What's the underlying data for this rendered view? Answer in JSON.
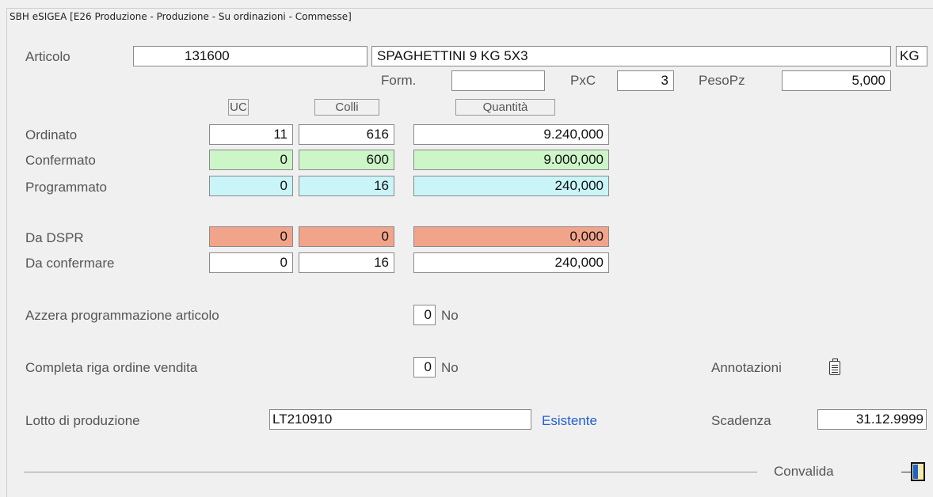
{
  "window": {
    "title": "SBH eSIGEA [E26 Produzione - Produzione - Su ordinazioni - Commesse]"
  },
  "articolo": {
    "label": "Articolo",
    "code": "131600",
    "description": "SPAGHETTINI 9 KG 5X3",
    "unit": "KG"
  },
  "format": {
    "form_label": "Form.",
    "form_value": "",
    "pxc_label": "PxC",
    "pxc_value": "3",
    "pesopz_label": "PesoPz",
    "pesopz_value": "5,000"
  },
  "columns": {
    "uc": "UC",
    "colli": "Colli",
    "quantita": "Quantità"
  },
  "rows": [
    {
      "label": "Ordinato",
      "uc": "11",
      "colli": "616",
      "quantita": "9.240,000"
    },
    {
      "label": "Confermato",
      "uc": "0",
      "colli": "600",
      "quantita": "9.000,000"
    },
    {
      "label": "Programmato",
      "uc": "0",
      "colli": "16",
      "quantita": "240,000"
    },
    {
      "label": "Da DSPR",
      "uc": "0",
      "colli": "0",
      "quantita": "0,000"
    },
    {
      "label": "Da confermare",
      "uc": "0",
      "colli": "16",
      "quantita": "240,000"
    }
  ],
  "azzera": {
    "label": "Azzera programmazione articolo",
    "value": "0",
    "text": "No"
  },
  "completa": {
    "label": "Completa riga ordine vendita",
    "value": "0",
    "text": "No"
  },
  "annotazioni": {
    "label": "Annotazioni",
    "icon": "notepad-icon"
  },
  "lotto": {
    "label": "Lotto di produzione",
    "value": "LT210910",
    "status": "Esistente",
    "status_color": "#1f5fd6"
  },
  "scadenza": {
    "label": "Scadenza",
    "value": "31.12.9999"
  },
  "convalida": {
    "label": "Convalida",
    "icon": "convalida-icon"
  },
  "colors": {
    "confermato": "#ccf5c8",
    "programmato": "#c9f5f8",
    "da_dspr": "#f2a48a"
  }
}
